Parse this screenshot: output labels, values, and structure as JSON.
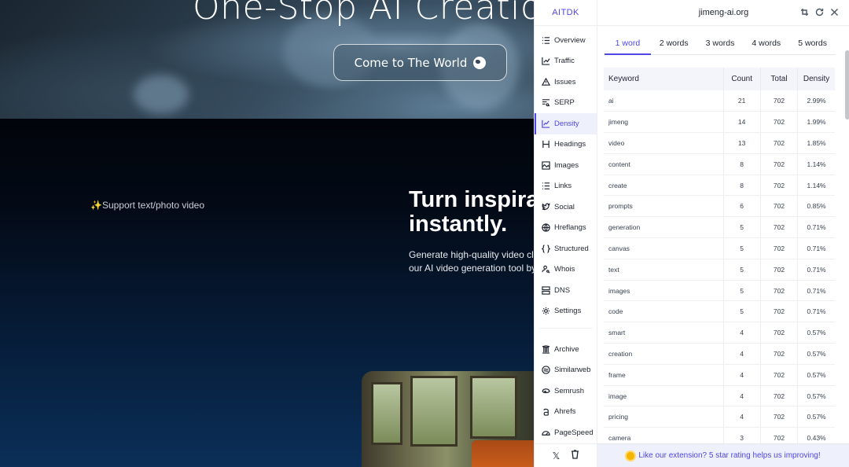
{
  "site": {
    "hero_title": "One-Stop AI Creation P",
    "hero_cta": "Come to The World",
    "feature_tag": "✨Support text/photo video",
    "section_title_1": "Turn inspira",
    "section_title_2": "instantly.",
    "section_desc_1": "Generate high-quality video clip",
    "section_desc_2": "our AI video generation tool by J"
  },
  "ext": {
    "brand": "AITDK",
    "domain": "jimeng-ai.org",
    "nav": [
      {
        "label": "Overview",
        "icon": "list-icon"
      },
      {
        "label": "Traffic",
        "icon": "chart-line-icon"
      },
      {
        "label": "Issues",
        "icon": "warning-icon"
      },
      {
        "label": "SERP",
        "icon": "serp-icon"
      },
      {
        "label": "Density",
        "icon": "density-chart-icon"
      },
      {
        "label": "Headings",
        "icon": "heading-icon"
      },
      {
        "label": "Images",
        "icon": "image-icon"
      },
      {
        "label": "Links",
        "icon": "link-list-icon"
      },
      {
        "label": "Social",
        "icon": "twitter-bird-icon"
      },
      {
        "label": "Hreflangs",
        "icon": "globe-icon"
      },
      {
        "label": "Structured",
        "icon": "braces-icon"
      },
      {
        "label": "Whois",
        "icon": "user-search-icon"
      },
      {
        "label": "DNS",
        "icon": "server-icon"
      },
      {
        "label": "Settings",
        "icon": "gear-icon"
      }
    ],
    "nav_active": "Density",
    "nav_tools": [
      {
        "label": "Archive",
        "icon": "archive-icon"
      },
      {
        "label": "Similarweb",
        "icon": "similarweb-icon"
      },
      {
        "label": "Semrush",
        "icon": "semrush-icon"
      },
      {
        "label": "Ahrefs",
        "icon": "ahrefs-icon"
      },
      {
        "label": "PageSpeed",
        "icon": "speedometer-icon"
      }
    ],
    "side_bottom": {
      "x_label": "𝕏",
      "cup_label": "🥤"
    },
    "tabs": [
      "1 word",
      "2 words",
      "3 words",
      "4 words",
      "5 words"
    ],
    "tab_active": "1 word",
    "table": {
      "headers": [
        "Keyword",
        "Count",
        "Total",
        "Density"
      ],
      "rows": [
        [
          "ai",
          "21",
          "702",
          "2.99%"
        ],
        [
          "jimeng",
          "14",
          "702",
          "1.99%"
        ],
        [
          "video",
          "13",
          "702",
          "1.85%"
        ],
        [
          "content",
          "8",
          "702",
          "1.14%"
        ],
        [
          "create",
          "8",
          "702",
          "1.14%"
        ],
        [
          "prompts",
          "6",
          "702",
          "0.85%"
        ],
        [
          "generation",
          "5",
          "702",
          "0.71%"
        ],
        [
          "canvas",
          "5",
          "702",
          "0.71%"
        ],
        [
          "text",
          "5",
          "702",
          "0.71%"
        ],
        [
          "images",
          "5",
          "702",
          "0.71%"
        ],
        [
          "code",
          "5",
          "702",
          "0.71%"
        ],
        [
          "smart",
          "4",
          "702",
          "0.57%"
        ],
        [
          "creation",
          "4",
          "702",
          "0.57%"
        ],
        [
          "frame",
          "4",
          "702",
          "0.57%"
        ],
        [
          "image",
          "4",
          "702",
          "0.57%"
        ],
        [
          "pricing",
          "4",
          "702",
          "0.57%"
        ],
        [
          "camera",
          "3",
          "702",
          "0.43%"
        ]
      ]
    },
    "footer_text": "Like our extension? 5 star rating helps us improving!",
    "colors": {
      "accent": "#4f46e5",
      "active_bg": "#eef0fb"
    }
  }
}
